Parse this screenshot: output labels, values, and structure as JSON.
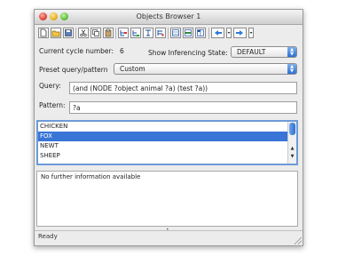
{
  "window": {
    "title": "Objects Browser 1"
  },
  "toolbar": {
    "icons": [
      "new-document-icon",
      "open-folder-icon",
      "save-disk-icon",
      "cut-icon",
      "copy-icon",
      "paste-icon",
      "tree-icon-1",
      "tree-icon-2",
      "tree-icon-3",
      "tree-icon-4",
      "grid-icon-1",
      "grid-icon-2",
      "grid-icon-3",
      "back-arrow-icon",
      "forward-arrow-icon"
    ]
  },
  "cycle": {
    "label": "Current cycle number:",
    "value": "6"
  },
  "inferencing": {
    "label": "Show Inferencing State:",
    "value": "DEFAULT"
  },
  "preset": {
    "label": "Preset query/pattern",
    "value": "Custom"
  },
  "query": {
    "label": "Query:",
    "value": "(and (NODE ?object animal ?a) (test ?a))"
  },
  "pattern": {
    "label": "Pattern:",
    "value": "?a"
  },
  "results": {
    "items": [
      "CHICKEN",
      "FOX",
      "NEWT",
      "SHEEP"
    ],
    "selected_index": 1
  },
  "detail": {
    "text": "No further information available"
  },
  "status": {
    "text": "Ready"
  },
  "colors": {
    "selection": "#3875d7",
    "accent": "#2b6fd3"
  }
}
